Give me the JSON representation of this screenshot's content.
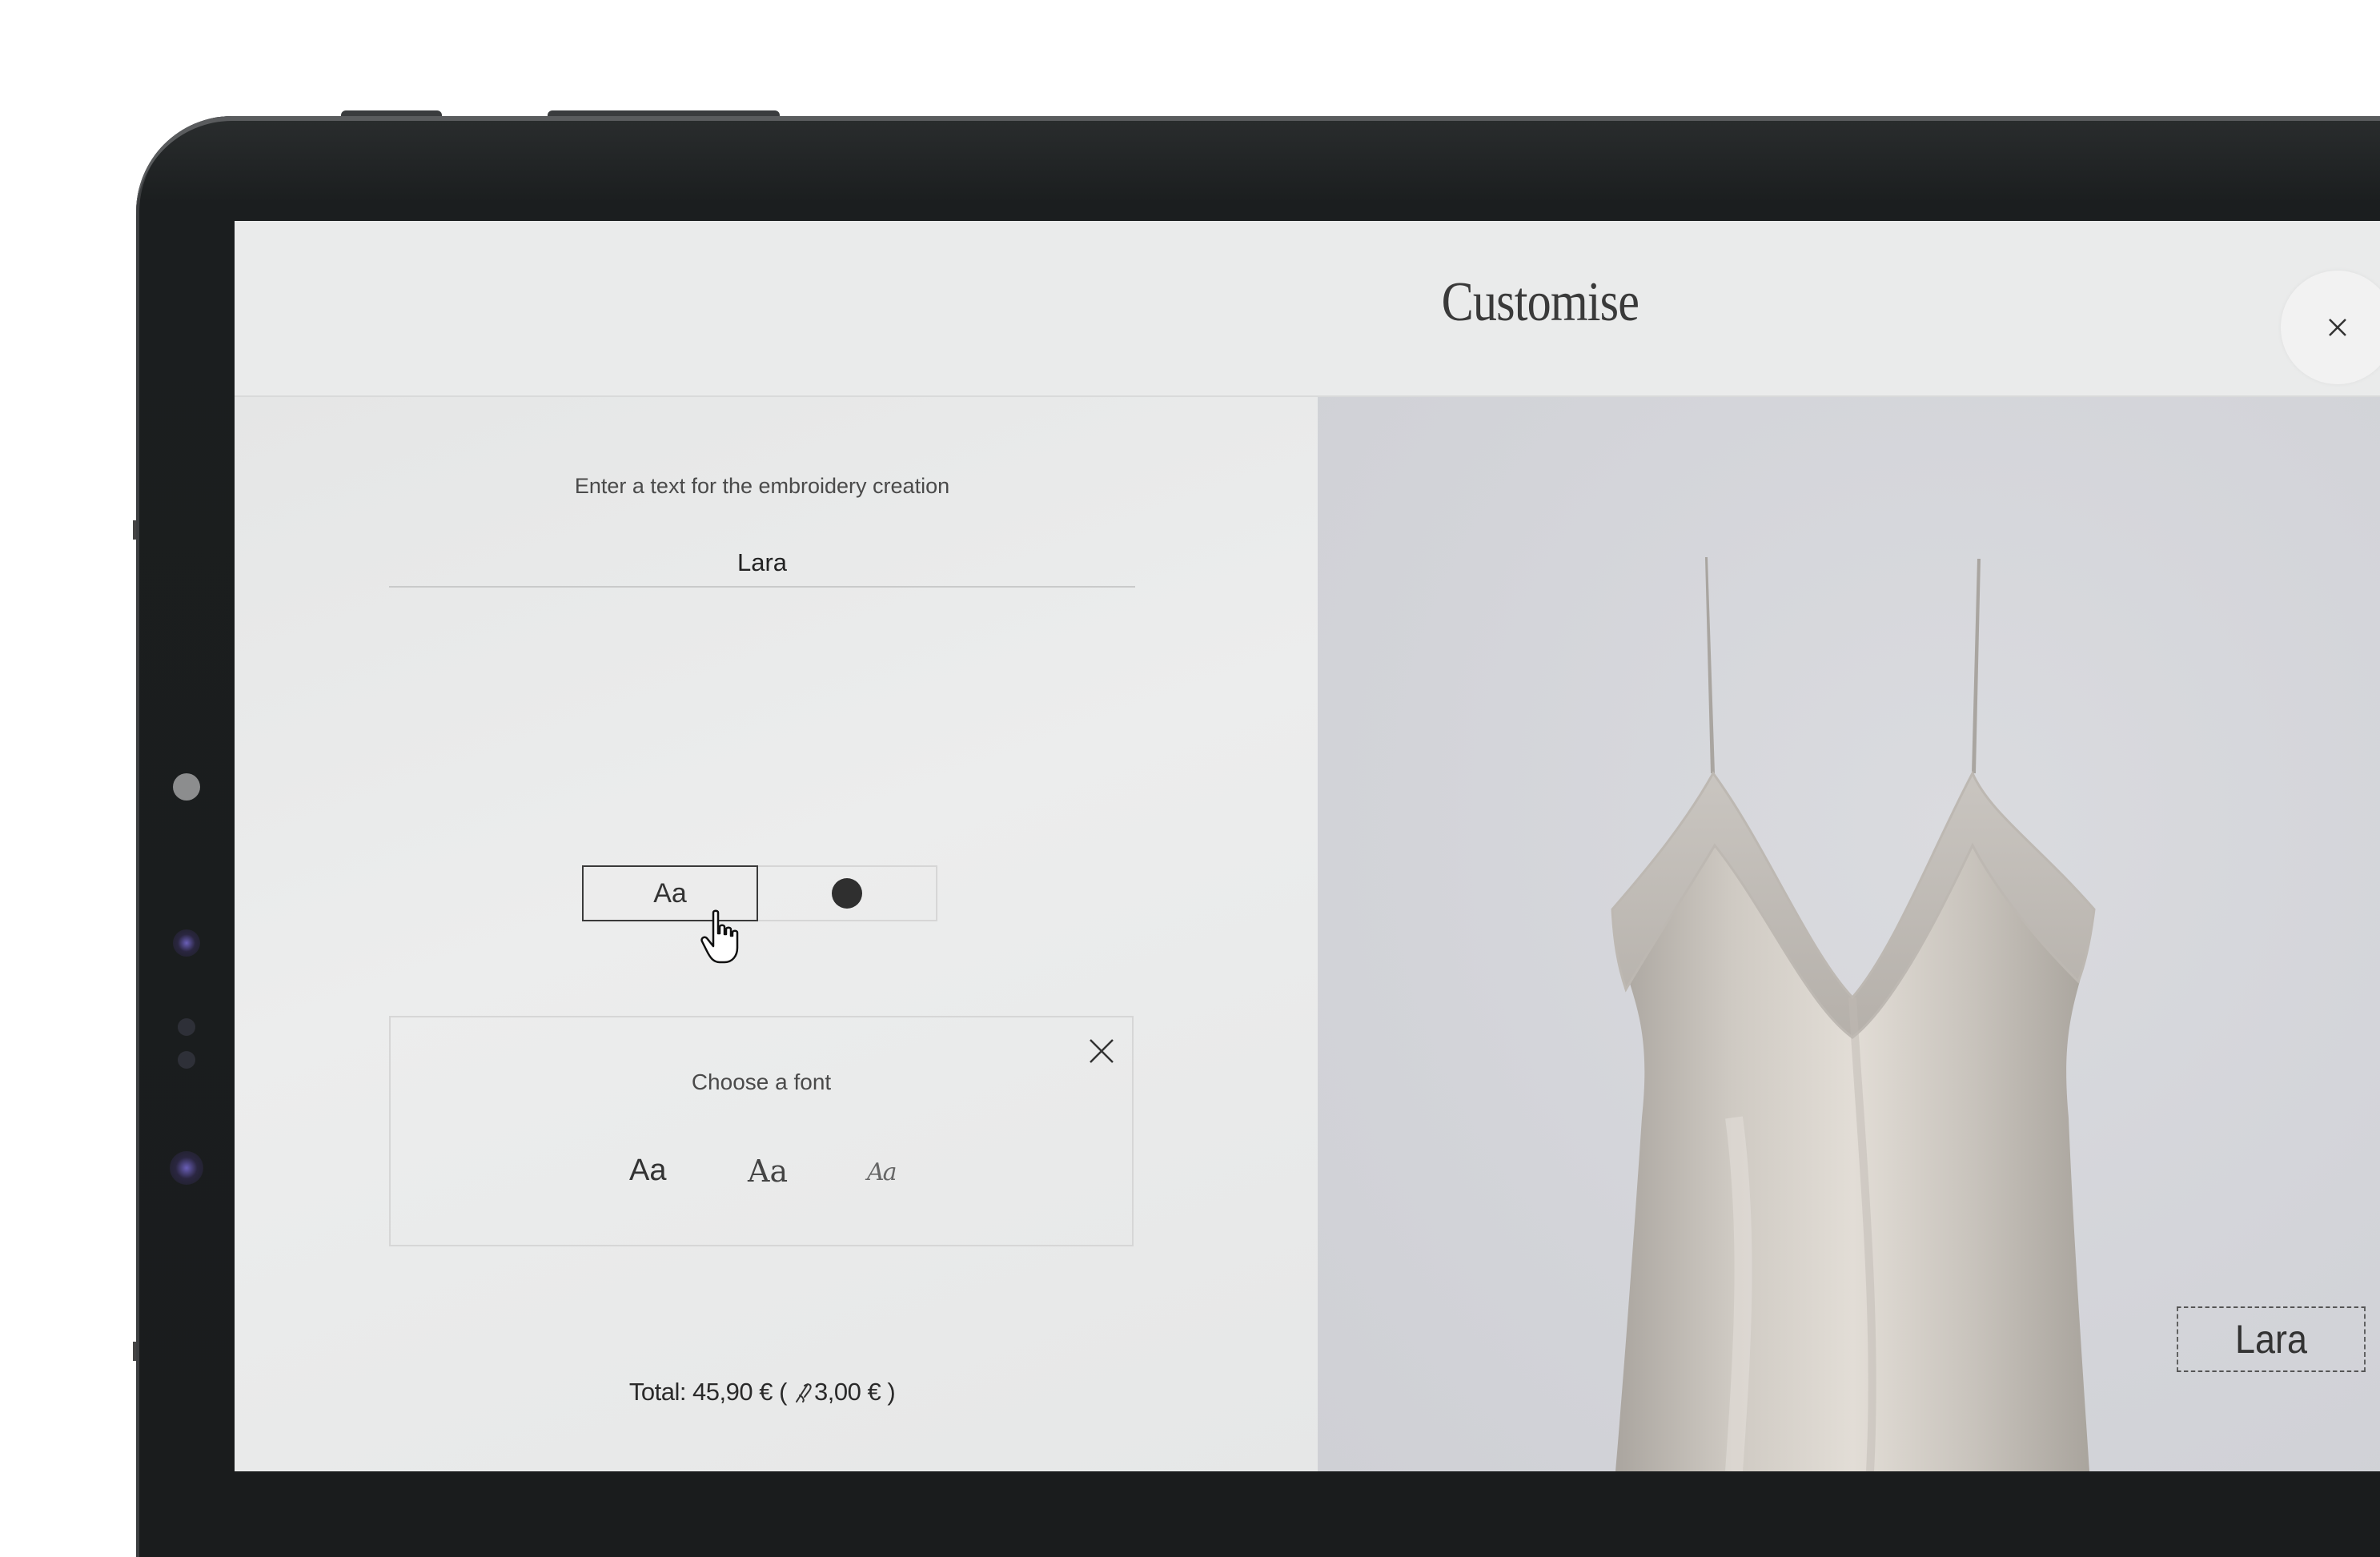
{
  "modal": {
    "title": "Customise"
  },
  "form": {
    "prompt": "Enter a text for the embroidery creation",
    "text_value": "Lara",
    "font_tab_label": "Aa",
    "thread_color": "#2f2f2f"
  },
  "font_panel": {
    "title": "Choose a font",
    "options": [
      "Aa",
      "Aa",
      "Aa"
    ]
  },
  "summary": {
    "total": "Total: 45,90 € ( ",
    "extra": "3,00 € )"
  },
  "preview": {
    "embroidery_text": "Lara"
  },
  "colors": {
    "accent": "#3a3a3a",
    "panel_bg": "#e8e9e9",
    "preview_bg": "#d4d5da"
  }
}
